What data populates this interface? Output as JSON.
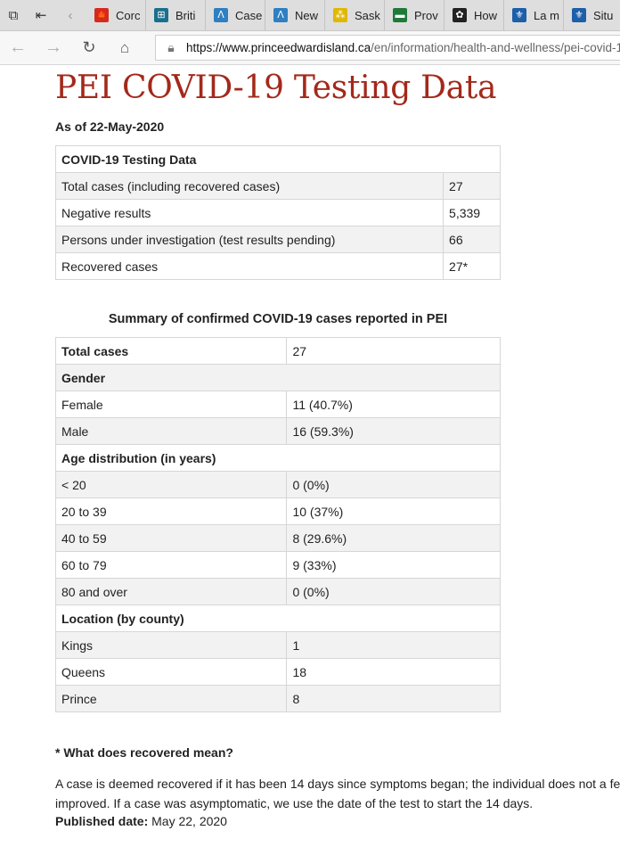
{
  "browser": {
    "tabs": [
      {
        "label": "Corc",
        "icon": "canada-flag-icon",
        "color": "#d52b1e",
        "glyph": "🍁"
      },
      {
        "label": "Briti",
        "icon": "bc-gov-icon",
        "color": "#1b6f8d",
        "glyph": "⊞"
      },
      {
        "label": "Case",
        "icon": "alberta-icon",
        "color": "#2f7fc1",
        "glyph": "ᐱ"
      },
      {
        "label": "New",
        "icon": "alberta-icon",
        "color": "#2f7fc1",
        "glyph": "ᐱ"
      },
      {
        "label": "Sask",
        "icon": "saskatchewan-icon",
        "color": "#e0b800",
        "glyph": "⁂"
      },
      {
        "label": "Prov",
        "icon": "manitoba-icon",
        "color": "#1f7a3a",
        "glyph": "▬"
      },
      {
        "label": "How",
        "icon": "ontario-icon",
        "color": "#222222",
        "glyph": "✿"
      },
      {
        "label": "La m",
        "icon": "quebec-fleur-icon",
        "color": "#1d5fa8",
        "glyph": "⚜"
      },
      {
        "label": "Situ",
        "icon": "quebec-fleur-icon",
        "color": "#1d5fa8",
        "glyph": "⚜"
      }
    ],
    "url_host": "https://www.princeedwardisland.ca",
    "url_path": "/en/information/health-and-wellness/pei-covid-1"
  },
  "page": {
    "title": "PEI COVID-19 Testing Data",
    "as_of": "As of 22-May-2020",
    "testing_table": {
      "header": "COVID-19 Testing Data",
      "rows": [
        {
          "label": "Total cases (including recovered cases)",
          "value": "27"
        },
        {
          "label": "Negative results",
          "value": "5,339"
        },
        {
          "label": "Persons under investigation (test results pending)",
          "value": "66"
        },
        {
          "label": "Recovered cases",
          "value": "27*"
        }
      ]
    },
    "summary_title": "Summary of confirmed COVID-19 cases reported in PEI",
    "summary_table": {
      "total": {
        "label": "Total cases",
        "value": "27"
      },
      "gender_header": "Gender",
      "gender": [
        {
          "label": "Female",
          "value": "11 (40.7%)"
        },
        {
          "label": "Male",
          "value": "16 (59.3%)"
        }
      ],
      "age_header": "Age distribution (in years)",
      "age": [
        {
          "label": "< 20",
          "value": "0 (0%)"
        },
        {
          "label": "20 to 39",
          "value": "10 (37%)"
        },
        {
          "label": "40 to 59",
          "value": "8 (29.6%)"
        },
        {
          "label": "60 to 79",
          "value": "9 (33%)"
        },
        {
          "label": "80 and over",
          "value": "0 (0%)"
        }
      ],
      "location_header": "Location (by county)",
      "location": [
        {
          "label": "Kings",
          "value": "1"
        },
        {
          "label": "Queens",
          "value": "18"
        },
        {
          "label": "Prince",
          "value": "8"
        }
      ]
    },
    "note_heading": "* What does recovered mean?",
    "note_line1": "A case is deemed recovered if it has been 14 days since symptoms began; the individual does not a fe",
    "note_line2": "improved. If a case was asymptomatic, we use the date of the test to start the 14 days.",
    "published_label": "Published date:",
    "published_value": "May 22, 2020"
  }
}
